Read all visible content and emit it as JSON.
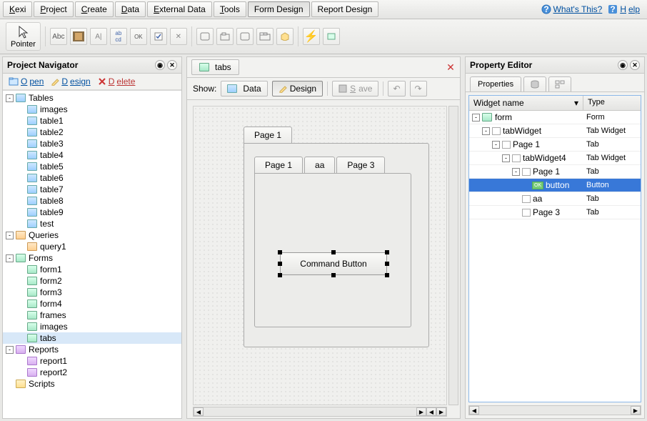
{
  "menubar": {
    "items": [
      "Kexi",
      "Project",
      "Create",
      "Data",
      "External Data",
      "Tools",
      "Form Design",
      "Report Design"
    ],
    "active": 6,
    "whats_this": "What's This?",
    "help": "Help"
  },
  "toolbar": {
    "pointer": "Pointer",
    "items": [
      "Abc",
      "img",
      "A",
      "abc",
      "OK",
      "chk",
      "x",
      "▭",
      "rect",
      "▭",
      "tabs",
      "fldr",
      "⚡",
      "ico"
    ]
  },
  "navigator": {
    "title": "Project Navigator",
    "actions": {
      "open": "Open",
      "design": "Design",
      "delete": "Delete"
    },
    "tree": {
      "tables": {
        "label": "Tables",
        "items": [
          "images",
          "table1",
          "table2",
          "table3",
          "table4",
          "table5",
          "table6",
          "table7",
          "table8",
          "table9",
          "test"
        ]
      },
      "queries": {
        "label": "Queries",
        "items": [
          "query1"
        ]
      },
      "forms": {
        "label": "Forms",
        "items": [
          "form1",
          "form2",
          "form3",
          "form4",
          "frames",
          "images",
          "tabs"
        ],
        "selected": "tabs"
      },
      "reports": {
        "label": "Reports",
        "items": [
          "report1",
          "report2"
        ]
      },
      "scripts": {
        "label": "Scripts"
      }
    }
  },
  "center": {
    "tab_label": "tabs",
    "show_label": "Show:",
    "data_btn": "Data",
    "design_btn": "Design",
    "save_btn": "Save",
    "outer_page": "Page 1",
    "inner_tabs": [
      "Page 1",
      "aa",
      "Page 3"
    ],
    "command_button": "Command Button"
  },
  "property": {
    "title": "Property Editor",
    "tab_label": "Properties",
    "col1": "Widget name",
    "col2": "Type",
    "rows": [
      {
        "indent": 0,
        "toggle": "-",
        "name": "form",
        "type": "Form",
        "icon": "form"
      },
      {
        "indent": 1,
        "toggle": "-",
        "name": "tabWidget",
        "type": "Tab Widget",
        "icon": "box"
      },
      {
        "indent": 2,
        "toggle": "-",
        "name": "Page 1",
        "type": "Tab",
        "icon": "box"
      },
      {
        "indent": 3,
        "toggle": "-",
        "name": "tabWidget4",
        "type": "Tab Widget",
        "icon": "box"
      },
      {
        "indent": 4,
        "toggle": "-",
        "name": "Page 1",
        "type": "Tab",
        "icon": "box"
      },
      {
        "indent": 5,
        "toggle": "",
        "name": "button",
        "type": "Button",
        "icon": "ok",
        "selected": true
      },
      {
        "indent": 4,
        "toggle": "",
        "name": "aa",
        "type": "Tab",
        "icon": "box"
      },
      {
        "indent": 4,
        "toggle": "",
        "name": "Page 3",
        "type": "Tab",
        "icon": "box"
      }
    ]
  }
}
